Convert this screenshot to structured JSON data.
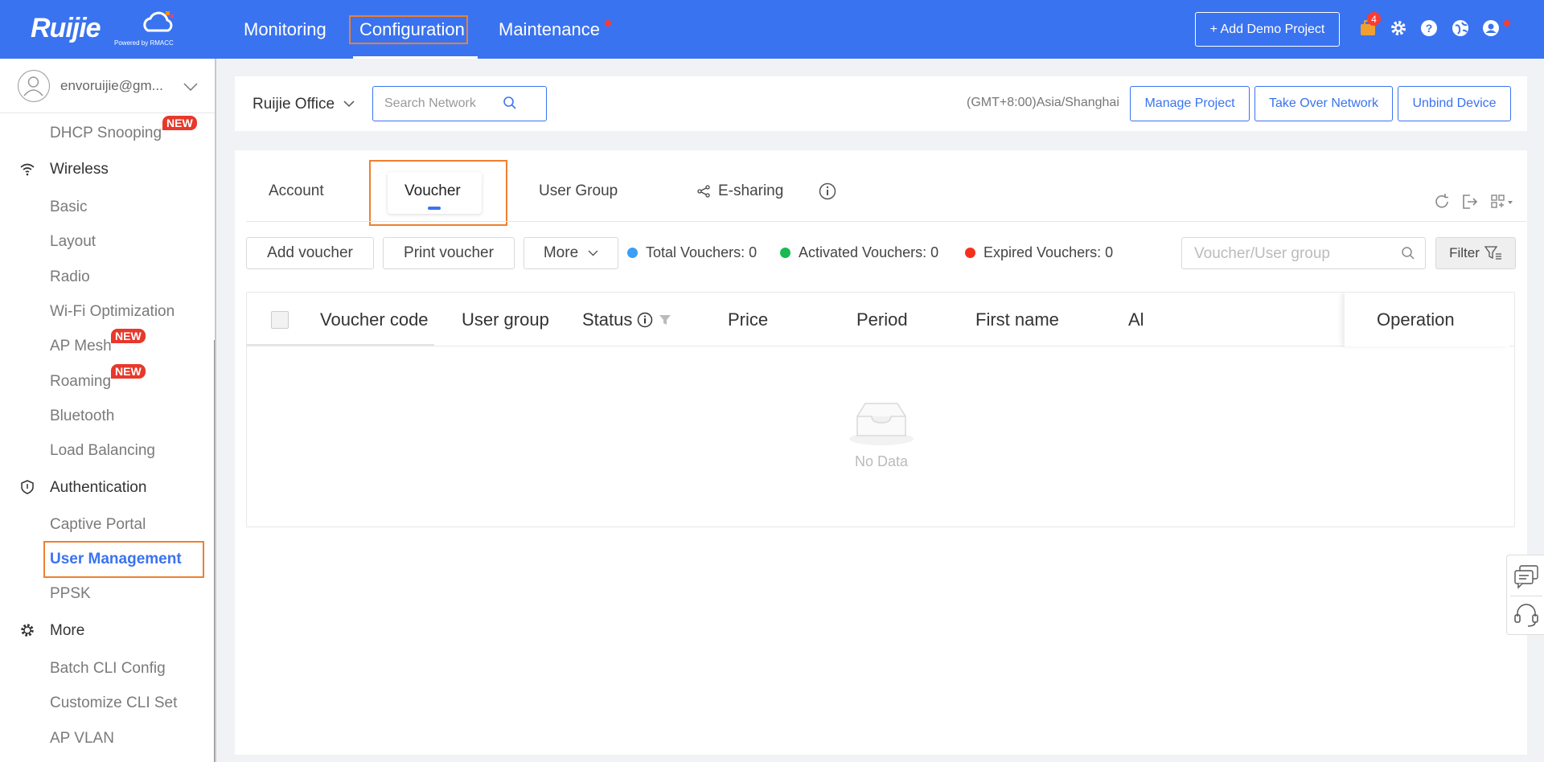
{
  "brand": {
    "logo_text": "Ruijie",
    "powered_by": "Powered by RMACC"
  },
  "topnav": {
    "items": [
      {
        "label": "Monitoring"
      },
      {
        "label": "Configuration"
      },
      {
        "label": "Maintenance"
      }
    ],
    "add_demo_label": "+ Add Demo Project",
    "notification_count": "4"
  },
  "sidebar": {
    "user": "envoruijie@gm...",
    "items": [
      {
        "label": "DHCP Snooping",
        "tag": "NEW"
      },
      {
        "label": "Wireless"
      },
      {
        "label": "Basic"
      },
      {
        "label": "Layout"
      },
      {
        "label": "Radio"
      },
      {
        "label": "Wi-Fi Optimization"
      },
      {
        "label": "AP Mesh",
        "tag": "NEW"
      },
      {
        "label": "Roaming",
        "tag": "NEW"
      },
      {
        "label": "Bluetooth"
      },
      {
        "label": "Load Balancing"
      },
      {
        "label": "Authentication"
      },
      {
        "label": "Captive Portal"
      },
      {
        "label": "User Management"
      },
      {
        "label": "PPSK"
      },
      {
        "label": "More"
      },
      {
        "label": "Batch CLI Config"
      },
      {
        "label": "Customize CLI Set"
      },
      {
        "label": "AP VLAN"
      }
    ]
  },
  "projbar": {
    "project": "Ruijie Office",
    "search_placeholder": "Search Network",
    "timezone": "(GMT+8:00)Asia/Shanghai",
    "buttons": [
      "Manage Project",
      "Take Over Network",
      "Unbind Device"
    ]
  },
  "tabs": [
    {
      "label": "Account"
    },
    {
      "label": "Voucher"
    },
    {
      "label": "User Group"
    },
    {
      "label": "E-sharing"
    }
  ],
  "toolbar": {
    "add_voucher": "Add voucher",
    "print_voucher": "Print voucher",
    "more": "More",
    "stats": [
      {
        "label": "Total Vouchers: 0",
        "color": "#3a9ff5"
      },
      {
        "label": "Activated Vouchers: 0",
        "color": "#1bb954"
      },
      {
        "label": "Expired Vouchers: 0",
        "color": "#f5311d"
      }
    ],
    "search_placeholder": "Voucher/User group",
    "filter": "Filter"
  },
  "table": {
    "columns": [
      "Voucher code",
      "User group",
      "Status",
      "Price",
      "Period",
      "First name",
      "Al",
      "Operation"
    ],
    "empty_text": "No Data"
  },
  "colors": {
    "primary": "#3a73f0",
    "highlight": "#f07f2f"
  }
}
